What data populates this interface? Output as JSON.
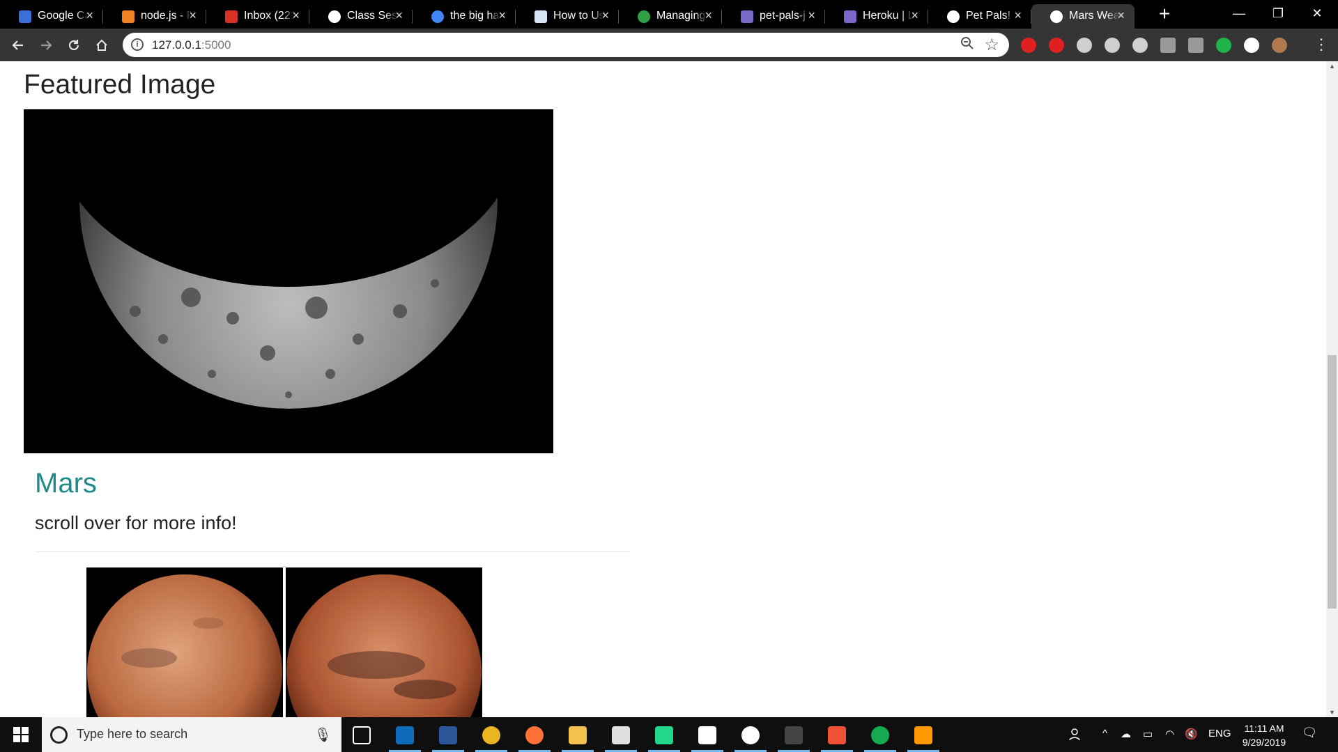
{
  "browser": {
    "tabs": [
      {
        "title": "Google Ca",
        "icon": "google-calendar-icon",
        "color": "#3b6fd8"
      },
      {
        "title": "node.js - F",
        "icon": "stack-overflow-icon",
        "color": "#f48024"
      },
      {
        "title": "Inbox (221",
        "icon": "gmail-icon",
        "color": "#d93025"
      },
      {
        "title": "Class Sessi",
        "icon": "globe-icon",
        "color": "#ffffff"
      },
      {
        "title": "the big ha",
        "icon": "google-icon",
        "color": "#4285f4"
      },
      {
        "title": "How to Us",
        "icon": "python-icon",
        "color": "#d6e4f5"
      },
      {
        "title": "Managing",
        "icon": "loading-ring-icon",
        "color": "#2ea043"
      },
      {
        "title": "pet-pals-j",
        "icon": "heroku-icon",
        "color": "#7b67c8"
      },
      {
        "title": "Heroku | L",
        "icon": "heroku-icon",
        "color": "#7b67c8"
      },
      {
        "title": "Pet Pals!",
        "icon": "globe-icon",
        "color": "#ffffff"
      },
      {
        "title": "Mars Wea",
        "icon": "globe-icon",
        "color": "#ffffff",
        "active": true
      }
    ],
    "new_tab_label": "+",
    "window_controls": {
      "minimize": "—",
      "maximize": "❐",
      "close": "✕"
    },
    "address": {
      "host": "127.0.0.1",
      "port": ":5000"
    },
    "extensions": [
      {
        "name": "red-extension-icon",
        "color": "#e02020"
      },
      {
        "name": "block-extension-icon",
        "color": "#e02020"
      },
      {
        "name": "circle-extension-icon",
        "color": "#cfcfcf"
      },
      {
        "name": "chat-extension-icon",
        "color": "#cfcfcf"
      },
      {
        "name": "gear-extension-icon",
        "color": "#cfcfcf"
      },
      {
        "name": "y-extension-icon",
        "color": "#9a9a9a"
      },
      {
        "name": "r-extension-icon",
        "color": "#9a9a9a"
      },
      {
        "name": "green-dot-extension-icon",
        "color": "#1fb34a"
      },
      {
        "name": "white-circle-extension-icon",
        "color": "#ffffff"
      },
      {
        "name": "profile-avatar",
        "color": "#b07a4e"
      }
    ]
  },
  "page": {
    "featured_title": "Featured Image",
    "mars_title": "Mars",
    "mars_subtitle": "scroll over for more info!"
  },
  "taskbar": {
    "search_placeholder": "Type here to search",
    "apps": [
      {
        "name": "task-view-icon",
        "color": "#ffffff"
      },
      {
        "name": "outlook-icon",
        "color": "#0f6cbd",
        "running": true
      },
      {
        "name": "word-icon",
        "color": "#2b579a",
        "running": true
      },
      {
        "name": "chrome-icon",
        "color": "#e8b620",
        "running": true
      },
      {
        "name": "firefox-icon",
        "color": "#ff7139",
        "running": true
      },
      {
        "name": "file-explorer-icon",
        "color": "#f2c14e",
        "running": true
      },
      {
        "name": "slack-icon",
        "color": "#e0e0e0",
        "running": true
      },
      {
        "name": "webstorm-icon",
        "color": "#21d789",
        "running": true
      },
      {
        "name": "photos-icon",
        "color": "#ffffff",
        "running": true
      },
      {
        "name": "github-icon",
        "color": "#ffffff",
        "running": true
      },
      {
        "name": "terminal-icon",
        "color": "#444444",
        "running": true
      },
      {
        "name": "git-icon",
        "color": "#f05033",
        "running": true
      },
      {
        "name": "mongodb-icon",
        "color": "#13aa52",
        "running": true
      },
      {
        "name": "sublime-icon",
        "color": "#ff9800",
        "running": true
      }
    ],
    "language": "ENG",
    "time": "11:11 AM",
    "date": "9/29/2019"
  }
}
